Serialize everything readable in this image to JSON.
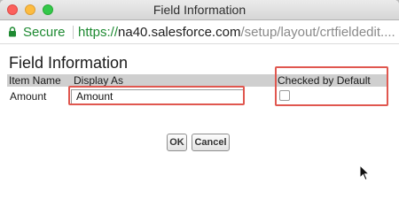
{
  "window": {
    "title": "Field Information"
  },
  "address_bar": {
    "secure_label": "Secure",
    "url_scheme": "https://",
    "url_host": "na40.salesforce.com",
    "url_path": "/setup/layout/crtfieldedit...."
  },
  "page": {
    "title": "Field Information",
    "columns": [
      "Item Name",
      "Display As",
      "Checked by Default"
    ],
    "row": {
      "item_name": "Amount",
      "display_as_value": "Amount",
      "checked_by_default": false
    }
  },
  "buttons": {
    "ok": "OK",
    "cancel": "Cancel"
  },
  "colors": {
    "highlight": "#e0574f",
    "secure_green": "#1e8a32",
    "table_header_bg": "#cfcfcf"
  }
}
